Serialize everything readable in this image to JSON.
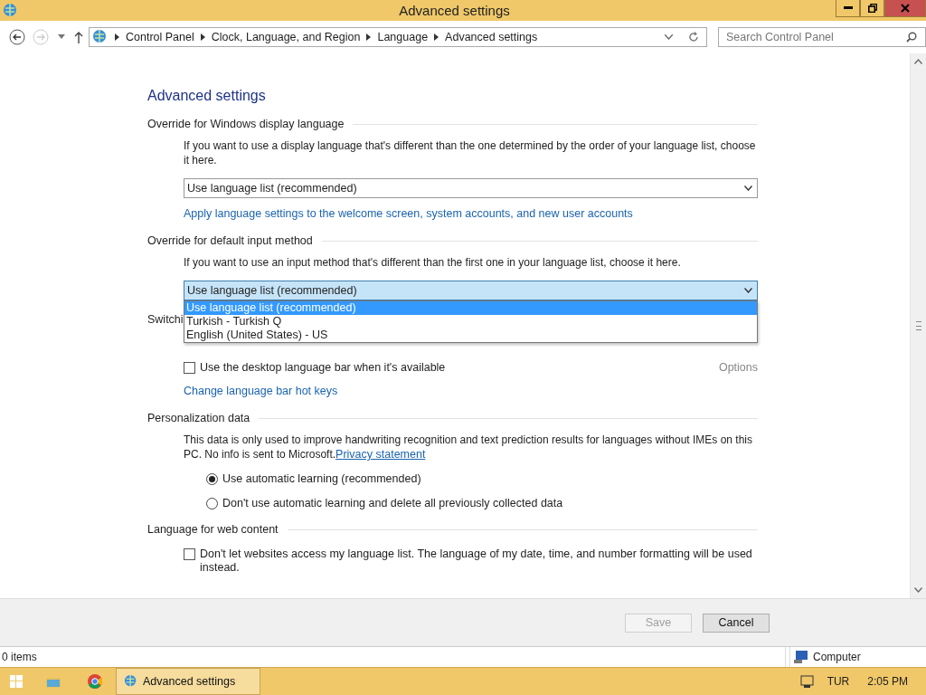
{
  "window": {
    "title": "Advanced settings"
  },
  "address_bar": {
    "breadcrumbs": [
      "Control Panel",
      "Clock, Language, and Region",
      "Language",
      "Advanced settings"
    ],
    "search_placeholder": "Search Control Panel"
  },
  "page_title": "Advanced settings",
  "sections": [
    {
      "heading": "Override for Windows display language",
      "items": [
        {
          "kind": "paragraph",
          "text": "If you want to use a display language that's different than the one determined by the order of your language list, choose it here."
        },
        {
          "kind": "select",
          "value": "Use language list (recommended)",
          "expanded": false
        },
        {
          "kind": "link",
          "text": "Apply language settings to the welcome screen, system accounts, and new user accounts"
        }
      ]
    },
    {
      "heading": "Override for default input method",
      "items": [
        {
          "kind": "paragraph",
          "text": "If you want to use an input method that's different than the first one in your language list, choose it here."
        },
        {
          "kind": "select",
          "value": "Use language list (recommended)",
          "expanded": true,
          "options": [
            {
              "label": "Use language list (recommended)",
              "selected": true
            },
            {
              "label": "Turkish - Turkish Q",
              "selected": false
            },
            {
              "label": "English (United States) - US",
              "selected": false
            }
          ]
        }
      ]
    },
    {
      "heading": "Switchi",
      "items": [
        {
          "kind": "covered_row"
        },
        {
          "kind": "checkbox",
          "label": "Use the desktop language bar when it's available",
          "checked": false,
          "option": "Options"
        },
        {
          "kind": "link",
          "text": "Change language bar hot keys"
        }
      ]
    },
    {
      "heading": "Personalization data",
      "items": [
        {
          "kind": "paragraph",
          "text": "This data is only used to improve handwriting recognition and text prediction results for languages without IMEs on this PC. No info is sent to Microsoft.",
          "link": "Privacy statement"
        },
        {
          "kind": "radio",
          "label": "Use automatic learning (recommended)",
          "selected": true
        },
        {
          "kind": "radio",
          "label": "Don't use automatic learning and delete all previously collected data",
          "selected": false
        }
      ]
    },
    {
      "heading": "Language for web content",
      "items": [
        {
          "kind": "checkbox",
          "label": "Don't let websites access my language list. The language of my date, time, and number formatting will be used instead.",
          "checked": false
        }
      ]
    }
  ],
  "buttons": [
    {
      "label": "Save",
      "disabled": true
    },
    {
      "label": "Cancel",
      "disabled": false
    }
  ],
  "status_bar": {
    "items": "0 items",
    "location": "Computer"
  },
  "taskbar": {
    "window": "Advanced settings",
    "language": "TUR",
    "time": "2:05 PM"
  }
}
